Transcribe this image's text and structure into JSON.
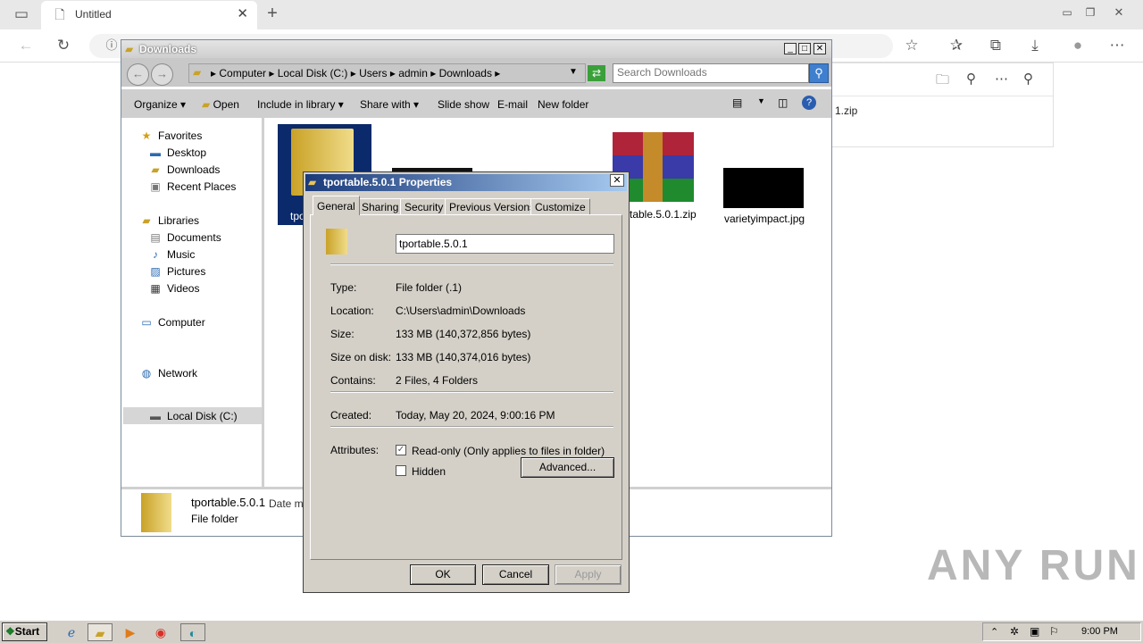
{
  "browser": {
    "tab_title": "Untitled",
    "downloads_flyout": {
      "file_partial": "1.zip"
    }
  },
  "explorer": {
    "title": "Downloads",
    "breadcrumbs": [
      "Computer",
      "Local Disk (C:)",
      "Users",
      "admin",
      "Downloads"
    ],
    "search_placeholder": "Search Downloads",
    "commands": {
      "organize": "Organize",
      "open": "Open",
      "include_in_library": "Include in library",
      "share_with": "Share with",
      "slide_show": "Slide show",
      "email": "E-mail",
      "new_folder": "New folder"
    },
    "nav": {
      "favorites": "Favorites",
      "desktop": "Desktop",
      "downloads": "Downloads",
      "recent_places": "Recent Places",
      "libraries": "Libraries",
      "documents": "Documents",
      "music": "Music",
      "pictures": "Pictures",
      "videos": "Videos",
      "computer": "Computer",
      "local_disk": "Local Disk (C:)",
      "network": "Network"
    },
    "files": [
      {
        "label": "tpo"
      },
      {
        "label": "rtable.5.0.1.zip"
      },
      {
        "label": "varietyimpact.jpg"
      }
    ],
    "details": {
      "name": "tportable.5.0.1",
      "date_partial": "Date mo",
      "type": "File folder"
    }
  },
  "properties": {
    "title": "tportable.5.0.1 Properties",
    "tabs": [
      "General",
      "Sharing",
      "Security",
      "Previous Versions",
      "Customize"
    ],
    "name_value": "tportable.5.0.1",
    "rows": {
      "type_label": "Type:",
      "type_value": "File folder (.1)",
      "location_label": "Location:",
      "location_value": "C:\\Users\\admin\\Downloads",
      "size_label": "Size:",
      "size_value": "133 MB (140,372,856 bytes)",
      "size_on_disk_label": "Size on disk:",
      "size_on_disk_value": "133 MB (140,374,016 bytes)",
      "contains_label": "Contains:",
      "contains_value": "2 Files, 4 Folders",
      "created_label": "Created:",
      "created_value": "Today, May 20, 2024, 9:00:16 PM",
      "attributes_label": "Attributes:"
    },
    "readonly_label": "Read-only (Only applies to files in folder)",
    "readonly_checked": true,
    "hidden_label": "Hidden",
    "hidden_checked": false,
    "advanced_label": "Advanced...",
    "ok_label": "OK",
    "cancel_label": "Cancel",
    "apply_label": "Apply"
  },
  "taskbar": {
    "start_label": "Start",
    "clock": "9:00 PM"
  },
  "watermark": "ANY RUN"
}
